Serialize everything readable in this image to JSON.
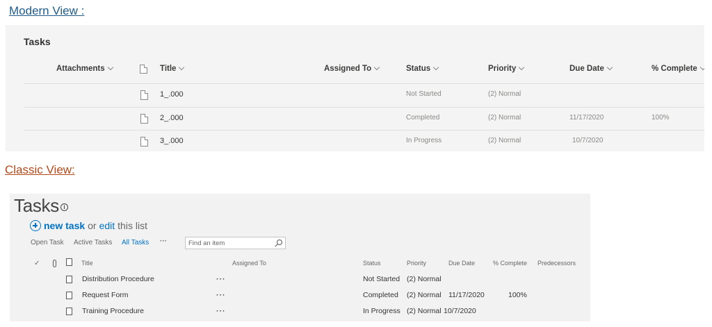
{
  "labels": {
    "modern_view": "Modern View :",
    "classic_view": "Classic View:"
  },
  "modern": {
    "title": "Tasks",
    "columns": {
      "attachments": "Attachments",
      "title": "Title",
      "assigned_to": "Assigned To",
      "status": "Status",
      "priority": "Priority",
      "due_date": "Due Date",
      "percent_complete": "% Complete"
    },
    "rows": [
      {
        "title": "1_.000",
        "status": "Not Started",
        "priority": "(2) Normal",
        "due_date": "",
        "percent_complete": ""
      },
      {
        "title": "2_.000",
        "status": "Completed",
        "priority": "(2) Normal",
        "due_date": "11/17/2020",
        "percent_complete": "100%"
      },
      {
        "title": "3_.000",
        "status": "In Progress",
        "priority": "(2) Normal",
        "due_date": "10/7/2020",
        "percent_complete": ""
      }
    ]
  },
  "classic": {
    "title": "Tasks",
    "info_symbol": "i",
    "new_task": "new task",
    "or": "or",
    "edit": "edit",
    "this_list": "this list",
    "views": {
      "open_task": "Open Task",
      "active_tasks": "Active Tasks",
      "all_tasks": "All Tasks",
      "more": "···"
    },
    "search_placeholder": "Find an item",
    "columns": {
      "check": "✓",
      "title": "Title",
      "assigned_to": "Assigned To",
      "status": "Status",
      "priority": "Priority",
      "due_date": "Due Date",
      "percent_complete": "% Complete",
      "predecessors": "Predecessors"
    },
    "rows": [
      {
        "title": "Distribution  Procedure",
        "menu": "···",
        "status": "Not Started",
        "priority": "(2) Normal",
        "due_date": "",
        "percent_complete": ""
      },
      {
        "title": "Request Form",
        "menu": "···",
        "status": "Completed",
        "priority": "(2) Normal",
        "due_date": "11/17/2020",
        "percent_complete": "100%"
      },
      {
        "title": "Training  Procedure",
        "menu": "···",
        "status": "In Progress",
        "priority": "(2) Normal",
        "due_date": "10/7/2020",
        "percent_complete": ""
      }
    ]
  },
  "colors": {
    "modern_heading": "#1f5c8b",
    "classic_heading": "#b2491a",
    "classic_link": "#0072c6"
  }
}
